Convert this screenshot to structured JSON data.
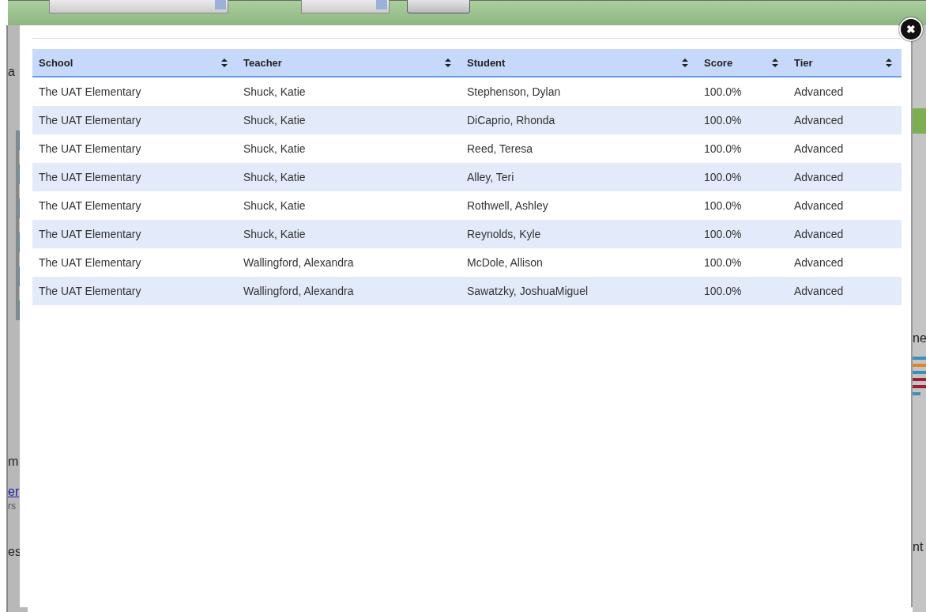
{
  "background": {
    "left_fragments": [
      "a",
      "m",
      "er",
      "rs",
      "es"
    ],
    "right_fragments": [
      "ne",
      "nt"
    ]
  },
  "modal": {
    "close_icon": "✖",
    "table": {
      "columns": [
        "School",
        "Teacher",
        "Student",
        "Score",
        "Tier"
      ],
      "rows": [
        [
          "The UAT Elementary",
          "Shuck, Katie",
          "Stephenson, Dylan",
          "100.0%",
          "Advanced"
        ],
        [
          "The UAT Elementary",
          "Shuck, Katie",
          "DiCaprio, Rhonda",
          "100.0%",
          "Advanced"
        ],
        [
          "The UAT Elementary",
          "Shuck, Katie",
          "Reed, Teresa",
          "100.0%",
          "Advanced"
        ],
        [
          "The UAT Elementary",
          "Shuck, Katie",
          "Alley, Teri",
          "100.0%",
          "Advanced"
        ],
        [
          "The UAT Elementary",
          "Shuck, Katie",
          "Rothwell, Ashley",
          "100.0%",
          "Advanced"
        ],
        [
          "The UAT Elementary",
          "Shuck, Katie",
          "Reynolds, Kyle",
          "100.0%",
          "Advanced"
        ],
        [
          "The UAT Elementary",
          "Wallingford, Alexandra",
          "McDole, Allison",
          "100.0%",
          "Advanced"
        ],
        [
          "The UAT Elementary",
          "Wallingford, Alexandra",
          "Sawatzky, JoshuaMiguel",
          "100.0%",
          "Advanced"
        ]
      ]
    }
  }
}
